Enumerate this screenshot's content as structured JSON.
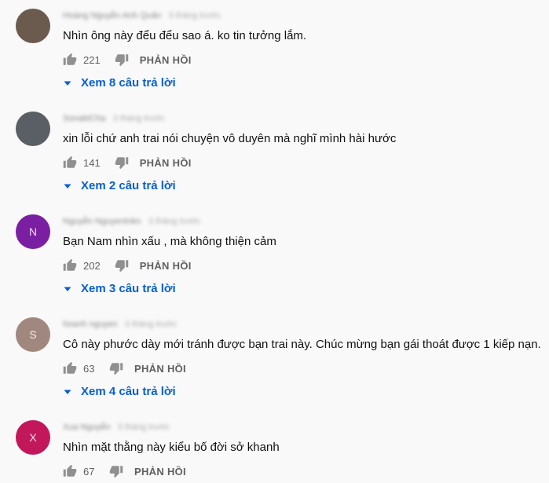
{
  "comments": [
    {
      "author": "Hoàng Nguyễn Anh Quân",
      "time": "3 tháng trước",
      "text": "Nhìn ông này đểu đểu sao á. ko tin tưởng lắm.",
      "likes": "221",
      "reply_label": "PHẢN HỒI",
      "view_replies": "Xem 8 câu trả lời",
      "avatar_color": "#6b5a4e",
      "avatar_letter": ""
    },
    {
      "author": "SonaktCha",
      "time": "3 tháng trước",
      "text": "xin lỗi chứ anh trai nói chuyện vô duyên mà nghĩ mình hài hước",
      "likes": "141",
      "reply_label": "PHẢN HỒI",
      "view_replies": "Xem 2 câu trả lời",
      "avatar_color": "#5a5f66",
      "avatar_letter": ""
    },
    {
      "author": "Nguyễn Nguyentnkn",
      "time": "3 tháng trước",
      "text": "Bạn Nam nhìn xấu , mà không thiện cảm",
      "likes": "202",
      "reply_label": "PHẢN HỒI",
      "view_replies": "Xem 3 câu trả lời",
      "avatar_color": "#7b1fa2",
      "avatar_letter": "N"
    },
    {
      "author": "hoanh nguyen",
      "time": "3 tháng trước",
      "text": "Cô này phước dày mới tránh được bạn trai này.  Chúc mừng bạn gái thoát được 1 kiếp nạn.",
      "likes": "63",
      "reply_label": "PHẢN HỒI",
      "view_replies": "Xem 4 câu trả lời",
      "avatar_color": "#a1887f",
      "avatar_letter": "S"
    },
    {
      "author": "Xua Nguyễn",
      "time": "3 tháng trước",
      "text": "Nhìn mặt thằng này kiểu bố đời sở khanh",
      "likes": "67",
      "reply_label": "PHẢN HỒI",
      "view_replies": "",
      "avatar_color": "#c2185b",
      "avatar_letter": "X"
    }
  ],
  "icons": {
    "like": "thumb-up-icon",
    "dislike": "thumb-down-icon",
    "expand": "caret-down-icon"
  },
  "colors": {
    "link": "#065fd4",
    "muted": "#606060",
    "background": "#f9f9f9"
  }
}
